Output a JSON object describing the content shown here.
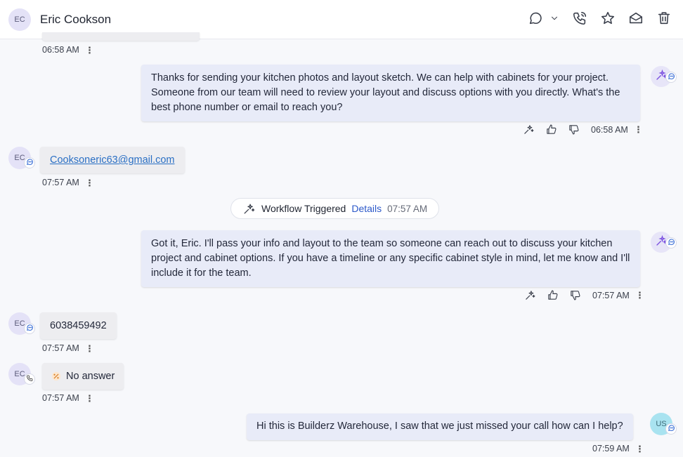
{
  "header": {
    "avatar_initials": "EC",
    "contact_name": "Eric Cookson",
    "icons": [
      "chat-bubble-icon",
      "chevron-down-icon",
      "phone-icon",
      "star-icon",
      "envelope-icon",
      "trash-icon"
    ]
  },
  "messages": [
    {
      "id": "m0",
      "direction": "in",
      "time": "06:58 AM"
    },
    {
      "id": "m1",
      "direction": "out",
      "sender": "ai",
      "text": "Thanks for sending your kitchen photos and layout sketch. We can help with cabinets for your project. Someone from our team will need to review your layout and discuss options with you directly. What's the best phone number or email to reach you?",
      "time": "06:58 AM"
    },
    {
      "id": "m2",
      "direction": "in",
      "avatar": "EC",
      "text": "Cooksoneric63@gmail.com",
      "time": "07:57 AM"
    },
    {
      "id": "m3",
      "direction": "out",
      "sender": "ai",
      "text": "Got it, Eric. I'll pass your info and layout to the team so someone can reach out to discuss your kitchen project and cabinet options. If you have a timeline or any specific cabinet style in mind, let me know and I'll include it for the team.",
      "time": "07:57 AM"
    },
    {
      "id": "m4",
      "direction": "in",
      "avatar": "EC",
      "text": "6038459492",
      "time": "07:57 AM"
    },
    {
      "id": "m5",
      "direction": "in",
      "avatar": "EC",
      "channel": "call",
      "text": "No answer",
      "time": "07:57 AM"
    },
    {
      "id": "m6",
      "direction": "out",
      "avatar": "US",
      "text": "Hi this is Builderz Warehouse, I saw that we just missed your call how can I help?",
      "time": "07:59 AM"
    }
  ],
  "workflow_event": {
    "label": "Workflow Triggered",
    "link": "Details",
    "time": "07:57 AM"
  },
  "colors": {
    "accent": "#2b58c9",
    "outgoing_bubble": "#e8ebf8",
    "incoming_bubble": "#ededf0",
    "ai_avatar": "#7a4fe0"
  }
}
